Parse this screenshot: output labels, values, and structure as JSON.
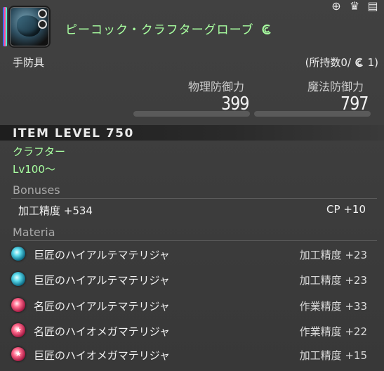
{
  "header": {
    "item_name": "ピーコック・クラフターグローブ",
    "category": "手防具",
    "owned": "(所持数0/",
    "owned_suffix": "1)"
  },
  "stats": {
    "physical_label": "物理防御力",
    "physical_value": "399",
    "magic_label": "魔法防御力",
    "magic_value": "797"
  },
  "item_level": "ITEM LEVEL 750",
  "requirements": {
    "job": "クラフター",
    "level": "Lv100～"
  },
  "bonuses": {
    "title": "Bonuses",
    "left": "加工精度 +534",
    "right": "CP +10"
  },
  "materia": {
    "title": "Materia",
    "items": [
      {
        "name": "巨匠のハイアルテマテリジャ",
        "stat": "加工精度 +23",
        "color": "blue",
        "icon": "materia-orb-icon"
      },
      {
        "name": "巨匠のハイアルテマテリジャ",
        "stat": "加工精度 +23",
        "color": "blue",
        "icon": "materia-orb-icon"
      },
      {
        "name": "名匠のハイアルテマテリジャ",
        "stat": "作業精度 +33",
        "color": "red",
        "icon": "materia-orb-icon"
      },
      {
        "name": "名匠のハイオメガマテリジャ",
        "stat": "作業精度 +22",
        "color": "red",
        "icon": "materia-star-icon"
      },
      {
        "name": "巨匠のハイオメガマテリジャ",
        "stat": "加工精度 +15",
        "color": "red",
        "icon": "materia-star-icon"
      }
    ]
  },
  "colors": {
    "name_green": "#a8ffa0",
    "background": "#3a3a3a"
  }
}
